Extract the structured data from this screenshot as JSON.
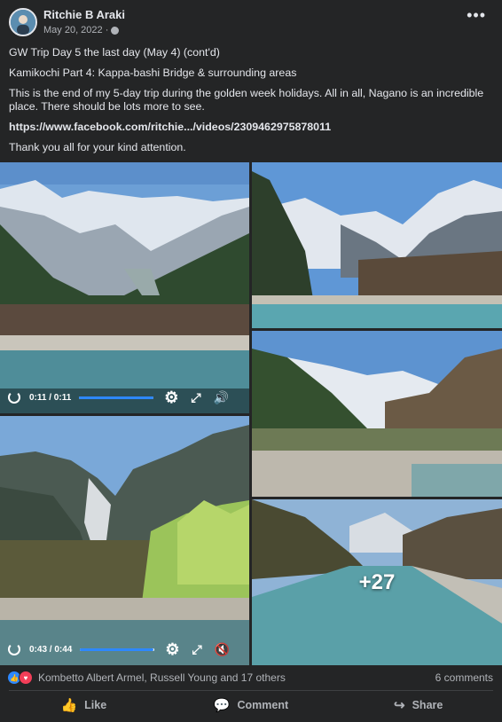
{
  "post": {
    "author": "Ritchie B Araki",
    "date": "May 20, 2022 ·",
    "more_label": "•••",
    "lines": [
      "GW Trip Day 5 the last day (May 4) (cont'd)",
      "Kamikochi Part 4: Kappa-bashi Bridge & surrounding areas",
      "This is the end of my 5-day trip during the golden week holidays.  All in all, Nagano is an incredible place.  There should be lots more to see."
    ],
    "link": "https://www.facebook.com/ritchie.../videos/2309462975878011",
    "closing": "Thank you all for your kind attention."
  },
  "media": {
    "video1": {
      "time": "0:11 / 0:11",
      "progress": 1.0
    },
    "video2": {
      "time": "0:43 / 0:44",
      "progress": 0.98
    },
    "more_count": "+27"
  },
  "reactions": {
    "names": "Kombetto Albert Armel, Russell Young and 17 others",
    "comments": "6 comments"
  },
  "actions": {
    "like": "Like",
    "comment": "Comment",
    "share": "Share"
  },
  "colors": {
    "background": "#242526",
    "accent": "#2d88ff",
    "love": "#f33e58"
  }
}
